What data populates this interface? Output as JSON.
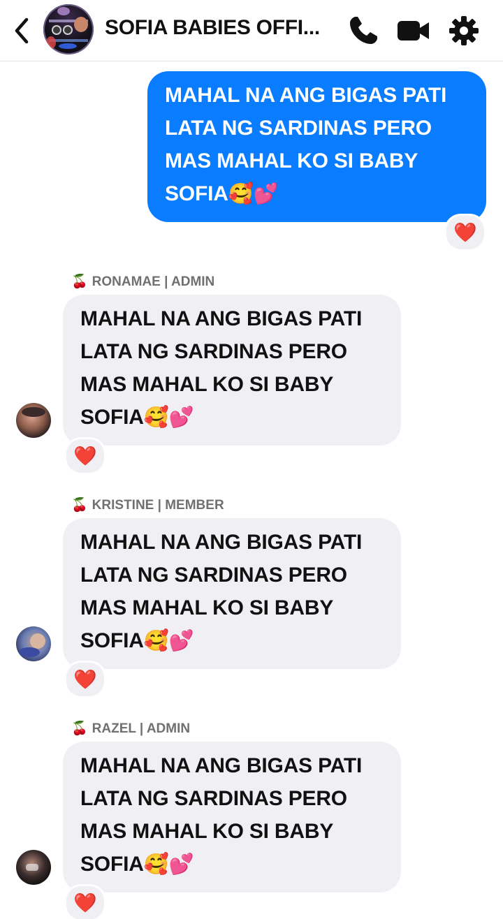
{
  "header": {
    "title": "SOFIA BABIES OFFI...",
    "back_icon": "chevron-left-icon",
    "call_icon": "phone-icon",
    "video_icon": "video-camera-icon",
    "settings_icon": "gear-icon"
  },
  "messages": [
    {
      "direction": "outgoing",
      "lines": [
        "MAHAL NA ANG BIGAS PATI",
        "LATA NG SARDINAS PERO",
        "MAS MAHAL KO SI BABY",
        "SOFIA"
      ],
      "emoji": "🥰💕",
      "reaction": "❤️"
    },
    {
      "direction": "incoming",
      "sender_prefix": "🍒",
      "sender": "RONAMAE | ADMIN",
      "lines": [
        "MAHAL NA ANG BIGAS PATI",
        "LATA NG SARDINAS PERO",
        "MAS MAHAL KO SI BABY",
        "SOFIA"
      ],
      "emoji": "🥰💕",
      "reaction": "❤️"
    },
    {
      "direction": "incoming",
      "sender_prefix": "🍒",
      "sender": "KRISTINE | MEMBER",
      "lines": [
        "MAHAL NA ANG BIGAS PATI",
        "LATA NG SARDINAS PERO",
        "MAS MAHAL KO SI BABY",
        "SOFIA"
      ],
      "emoji": "🥰💕",
      "reaction": "❤️"
    },
    {
      "direction": "incoming",
      "sender_prefix": "🍒",
      "sender": "RAZEL | ADMIN",
      "lines": [
        "MAHAL NA ANG BIGAS PATI",
        "LATA NG SARDINAS PERO",
        "MAS MAHAL KO SI BABY",
        "SOFIA"
      ],
      "emoji": "🥰💕",
      "reaction": "❤️"
    }
  ],
  "colors": {
    "outgoing_bubble": "#0a7cff",
    "incoming_bubble": "#f0f0f4",
    "reaction_heart": "#e8332b"
  }
}
